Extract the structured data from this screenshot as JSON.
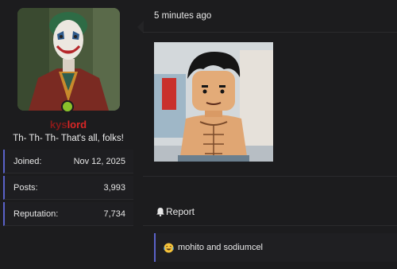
{
  "user": {
    "name_part1": "kys",
    "name_part2": "lord",
    "title": "Th- Th- Th- That's all, folks!",
    "online": true,
    "stats": [
      {
        "label": "Joined:",
        "value": "Nov 12, 2025"
      },
      {
        "label": "Posts:",
        "value": "3,993"
      },
      {
        "label": "Reputation:",
        "value": "7,734"
      }
    ]
  },
  "post": {
    "timestamp": "5 minutes ago",
    "report_label": "Report",
    "reactions_text": "mohito and sodiumcel"
  },
  "colors": {
    "accent": "#5a62c9",
    "online": "#8ac22b",
    "username_dark": "#8a1a1a",
    "username_red": "#d92626"
  },
  "icons": {
    "online": "online-status-dot",
    "report": "bell-icon",
    "reaction": "laughing-crying-emoji-icon"
  }
}
